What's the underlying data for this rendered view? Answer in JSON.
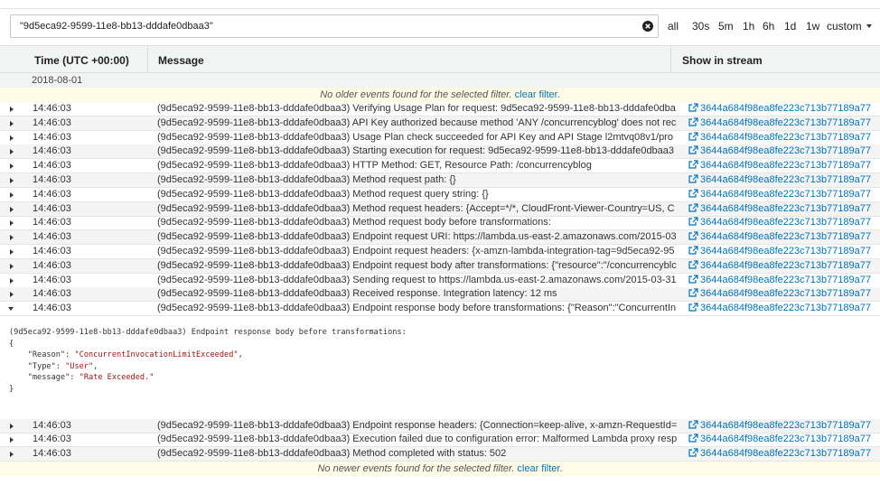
{
  "filter": {
    "value": "\"9d5eca92-9599-11e8-bb13-dddafe0dbaa3\""
  },
  "time_ranges": [
    "all",
    "30s",
    "5m",
    "1h",
    "6h",
    "1d",
    "1w",
    "custom"
  ],
  "columns": {
    "time": "Time (UTC +00:00)",
    "message": "Message",
    "stream": "Show in stream"
  },
  "date": "2018-08-01",
  "notices": {
    "older": "No older events found for the selected filter.",
    "newer": "No newer events found for the selected filter.",
    "clear": "clear filter."
  },
  "stream_id": "3644a684f98ea8fe223c713b77189a77",
  "events": [
    {
      "time": "14:46:03",
      "message": "(9d5eca92-9599-11e8-bb13-dddafe0dbaa3) Verifying Usage Plan for request: 9d5eca92-9599-11e8-bb13-dddafe0dba"
    },
    {
      "time": "14:46:03",
      "message": "(9d5eca92-9599-11e8-bb13-dddafe0dbaa3) API Key authorized because method 'ANY /concurrencyblog' does not rec"
    },
    {
      "time": "14:46:03",
      "message": "(9d5eca92-9599-11e8-bb13-dddafe0dbaa3) Usage Plan check succeeded for API Key and API Stage l2mtvq08v1/pro"
    },
    {
      "time": "14:46:03",
      "message": "(9d5eca92-9599-11e8-bb13-dddafe0dbaa3) Starting execution for request: 9d5eca92-9599-11e8-bb13-dddafe0dbaa3"
    },
    {
      "time": "14:46:03",
      "message": "(9d5eca92-9599-11e8-bb13-dddafe0dbaa3) HTTP Method: GET, Resource Path: /concurrencyblog"
    },
    {
      "time": "14:46:03",
      "message": "(9d5eca92-9599-11e8-bb13-dddafe0dbaa3) Method request path: {}"
    },
    {
      "time": "14:46:03",
      "message": "(9d5eca92-9599-11e8-bb13-dddafe0dbaa3) Method request query string: {}"
    },
    {
      "time": "14:46:03",
      "message": "(9d5eca92-9599-11e8-bb13-dddafe0dbaa3) Method request headers: {Accept=*/*, CloudFront-Viewer-Country=US, C"
    },
    {
      "time": "14:46:03",
      "message": "(9d5eca92-9599-11e8-bb13-dddafe0dbaa3) Method request body before transformations:"
    },
    {
      "time": "14:46:03",
      "message": "(9d5eca92-9599-11e8-bb13-dddafe0dbaa3) Endpoint request URI: https://lambda.us-east-2.amazonaws.com/2015-03"
    },
    {
      "time": "14:46:03",
      "message": "(9d5eca92-9599-11e8-bb13-dddafe0dbaa3) Endpoint request headers: {x-amzn-lambda-integration-tag=9d5eca92-95"
    },
    {
      "time": "14:46:03",
      "message": "(9d5eca92-9599-11e8-bb13-dddafe0dbaa3) Endpoint request body after transformations: {\"resource\":\"/concurrencyblc"
    },
    {
      "time": "14:46:03",
      "message": "(9d5eca92-9599-11e8-bb13-dddafe0dbaa3) Sending request to https://lambda.us-east-2.amazonaws.com/2015-03-31"
    },
    {
      "time": "14:46:03",
      "message": "(9d5eca92-9599-11e8-bb13-dddafe0dbaa3) Received response. Integration latency: 12 ms"
    },
    {
      "time": "14:46:03",
      "message": "(9d5eca92-9599-11e8-bb13-dddafe0dbaa3) Endpoint response body before transformations: {\"Reason\":\"ConcurrentIn"
    },
    {
      "time": "14:46:03",
      "message": "(9d5eca92-9599-11e8-bb13-dddafe0dbaa3) Endpoint response headers: {Connection=keep-alive, x-amzn-RequestId="
    },
    {
      "time": "14:46:03",
      "message": "(9d5eca92-9599-11e8-bb13-dddafe0dbaa3) Execution failed due to configuration error: Malformed Lambda proxy resp"
    },
    {
      "time": "14:46:03",
      "message": "(9d5eca92-9599-11e8-bb13-dddafe0dbaa3) Method completed with status: 502"
    }
  ],
  "expanded": {
    "header": "(9d5eca92-9599-11e8-bb13-dddafe0dbaa3) Endpoint response body before transformations:",
    "open_brace": "{",
    "close_brace": "}",
    "fields": [
      {
        "key": "\"Reason\"",
        "value": "\"ConcurrentInvocationLimitExceeded\"",
        "sep": ","
      },
      {
        "key": "\"Type\"",
        "value": "\"User\"",
        "sep": ","
      },
      {
        "key": "\"message\"",
        "value": "\"Rate Exceeded.\"",
        "sep": ""
      }
    ]
  },
  "colors": {
    "link": "#0073bb",
    "header_bg": "#f2f3f3",
    "notice_bg": "#fffbe6",
    "json_string": "#a31515"
  }
}
